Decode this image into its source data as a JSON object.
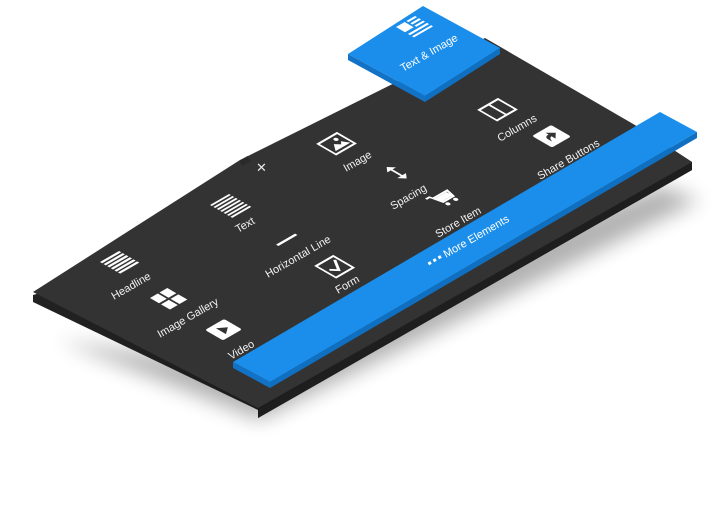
{
  "panel": {
    "close_icon": "close-icon",
    "tab": {
      "label": "Text & Image",
      "icon": "text-image-icon",
      "color": "#1a8eea"
    },
    "elements": [
      {
        "label": "Headline",
        "icon": "headline-icon"
      },
      {
        "label": "Image Gallery",
        "icon": "image-gallery-icon"
      },
      {
        "label": "Video",
        "icon": "video-icon"
      },
      {
        "label": "Text",
        "icon": "text-icon"
      },
      {
        "label": "Horizontal Line",
        "icon": "horizontal-line-icon"
      },
      {
        "label": "Form",
        "icon": "form-icon"
      },
      {
        "label": "Image",
        "icon": "image-icon"
      },
      {
        "label": "Spacing",
        "icon": "spacing-icon"
      },
      {
        "label": "Store Item",
        "icon": "store-item-icon"
      },
      {
        "label": "Columns",
        "icon": "columns-icon"
      },
      {
        "label": "Share Buttons",
        "icon": "share-buttons-icon"
      }
    ],
    "more_button": {
      "label": "More Elements",
      "icon": "dots-icon",
      "color": "#1a8eea"
    },
    "panel_color": "#333333"
  }
}
